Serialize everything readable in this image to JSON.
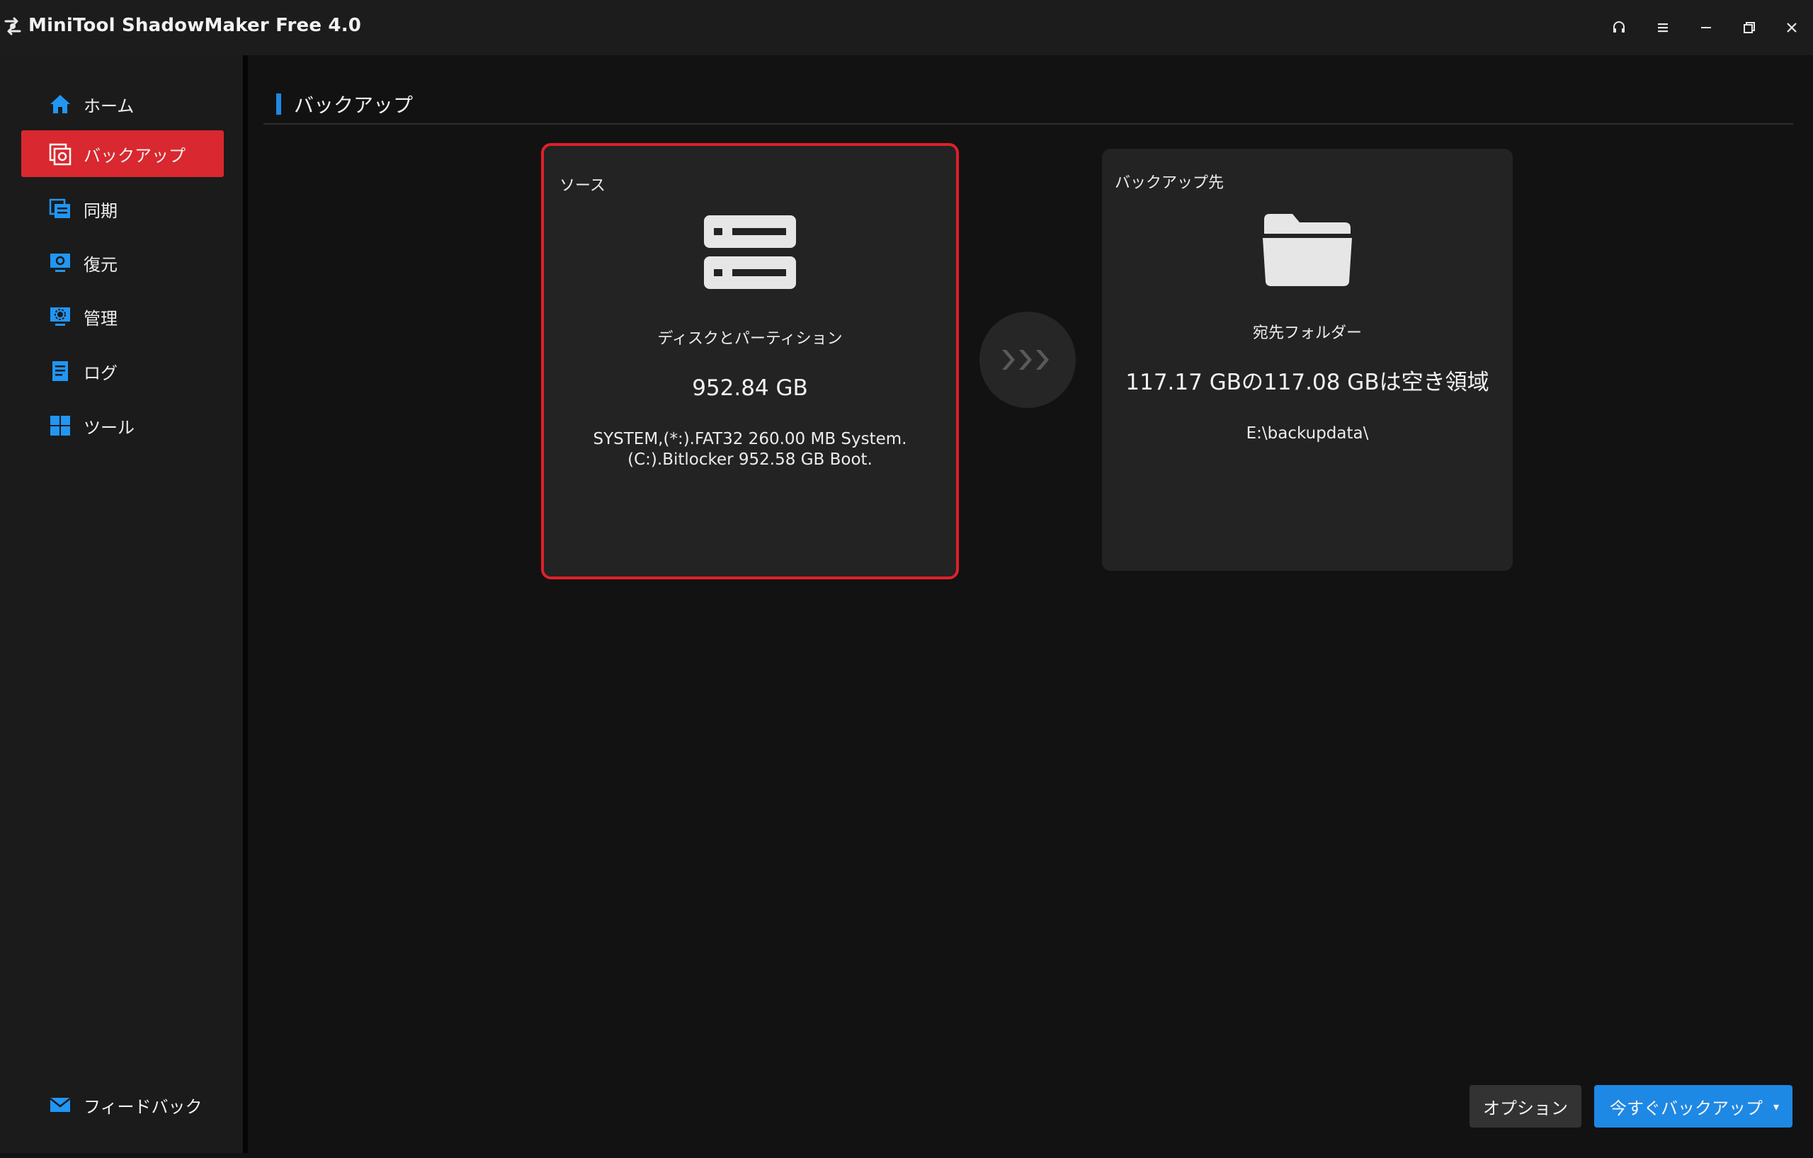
{
  "window": {
    "title": "MiniTool ShadowMaker Free 4.0",
    "controls": [
      "headset-icon",
      "menu-icon",
      "minimize-icon",
      "restore-icon",
      "close-icon"
    ]
  },
  "sidebar": {
    "items": [
      {
        "label": "ホーム",
        "icon": "home-icon",
        "active": false
      },
      {
        "label": "バックアップ",
        "icon": "backup-icon",
        "active": true
      },
      {
        "label": "同期",
        "icon": "sync-icon",
        "active": false
      },
      {
        "label": "復元",
        "icon": "restore-icon",
        "active": false
      },
      {
        "label": "管理",
        "icon": "manage-icon",
        "active": false
      },
      {
        "label": "ログ",
        "icon": "log-icon",
        "active": false
      },
      {
        "label": "ツール",
        "icon": "tools-icon",
        "active": false
      }
    ],
    "feedback_label": "フィードバック"
  },
  "main": {
    "title": "バックアップ",
    "source": {
      "label": "ソース",
      "title": "ディスクとパーティション",
      "size": "952.84 GB",
      "detail_line1": "SYSTEM,(*:).FAT32 260.00 MB System.",
      "detail_line2": "(C:).Bitlocker 952.58 GB Boot."
    },
    "destination": {
      "label": "バックアップ先",
      "title": "宛先フォルダー",
      "space": "117.17 GBの117.08 GBは空き領域",
      "path": "E:\\backupdata\\"
    },
    "options_label": "オプション",
    "backup_now_label": "今すぐバックアップ",
    "backup_caret": "▾"
  },
  "colors": {
    "accent_blue": "#1e88e5",
    "active_red": "#d9282f",
    "highlight_border": "#e0202a",
    "background": "#121212"
  }
}
